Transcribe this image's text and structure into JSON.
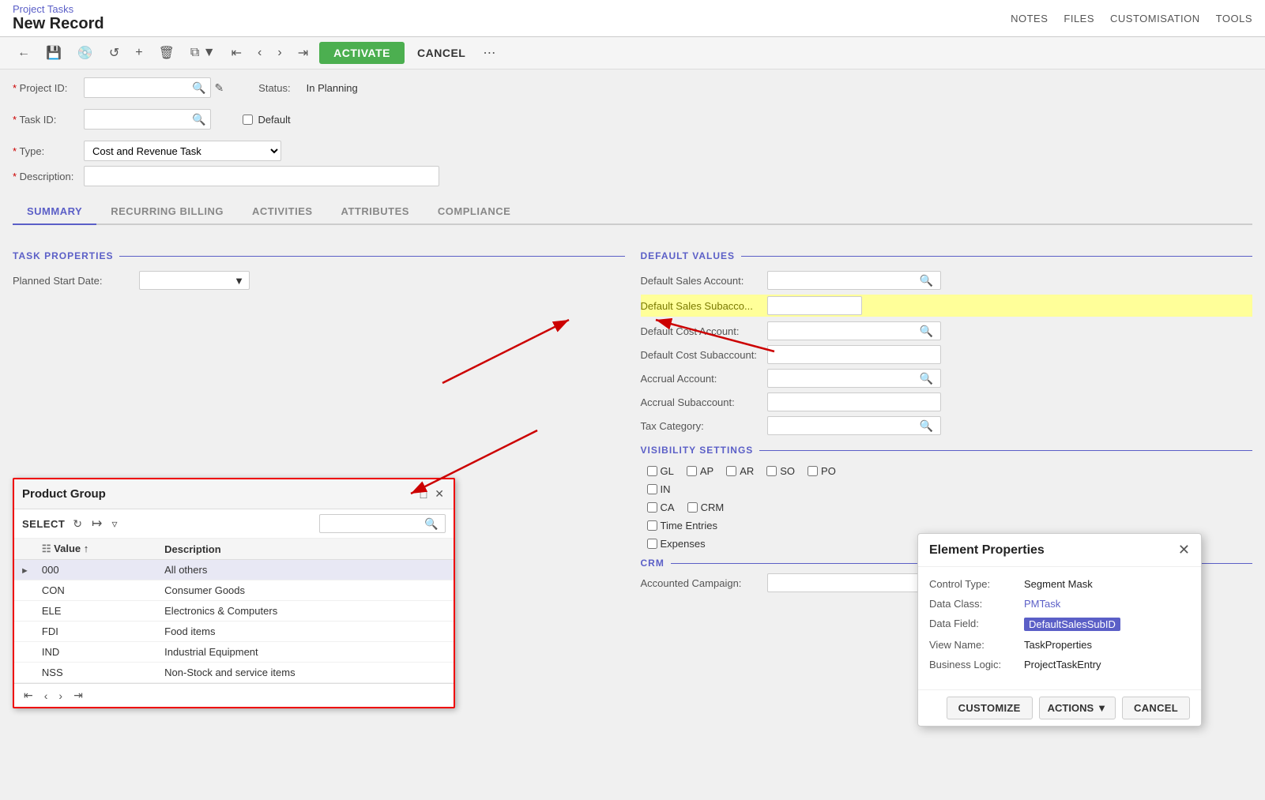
{
  "topbar": {
    "breadcrumb": "Project Tasks",
    "subtitle": "New Record",
    "notes_label": "NOTES",
    "files_label": "FILES",
    "customisation_label": "CUSTOMISATION",
    "tools_label": "TOOLS"
  },
  "toolbar": {
    "activate_label": "ACTIVATE",
    "cancel_label": "CANCEL"
  },
  "form": {
    "project_id_label": "Project ID:",
    "task_id_label": "Task ID:",
    "type_label": "Type:",
    "description_label": "Description:",
    "status_label": "Status:",
    "status_value": "In Planning",
    "default_checkbox_label": "Default",
    "type_value": "Cost and Revenue Task"
  },
  "tabs": [
    {
      "label": "SUMMARY"
    },
    {
      "label": "RECURRING BILLING"
    },
    {
      "label": "ACTIVITIES"
    },
    {
      "label": "ATTRIBUTES"
    },
    {
      "label": "COMPLIANCE"
    }
  ],
  "task_properties": {
    "section_label": "TASK PROPERTIES",
    "planned_start_date_label": "Planned Start Date:"
  },
  "default_values": {
    "section_label": "DEFAULT VALUES",
    "default_sales_account_label": "Default Sales Account:",
    "default_sales_subaccount_label": "Default Sales Subacco...",
    "default_cost_account_label": "Default Cost Account:",
    "default_cost_subaccount_label": "Default Cost Subaccount:",
    "accrual_account_label": "Accrual Account:",
    "accrual_subaccount_label": "Accrual Subaccount:",
    "tax_category_label": "Tax Category:",
    "dash_value": "—-—"
  },
  "visibility_settings": {
    "section_label": "VISIBILITY SETTINGS",
    "checkboxes": [
      {
        "id": "gl",
        "label": "GL"
      },
      {
        "id": "ap",
        "label": "AP"
      },
      {
        "id": "ar",
        "label": "AR"
      },
      {
        "id": "so",
        "label": "SO"
      },
      {
        "id": "po",
        "label": "PO"
      },
      {
        "id": "in",
        "label": "IN"
      },
      {
        "id": "ca",
        "label": "CA"
      },
      {
        "id": "crm",
        "label": "CRM"
      },
      {
        "id": "time",
        "label": "Time Entries"
      },
      {
        "id": "expenses",
        "label": "Expenses"
      }
    ]
  },
  "crm": {
    "section_label": "CRM",
    "accounted_campaign_label": "Accounted Campaign:"
  },
  "product_group_popup": {
    "title": "Product Group",
    "select_label": "SELECT",
    "columns": [
      {
        "label": "Value",
        "key": "value"
      },
      {
        "label": "Description",
        "key": "desc"
      }
    ],
    "rows": [
      {
        "expand": true,
        "value": "000",
        "desc": "All others",
        "selected": true
      },
      {
        "expand": false,
        "value": "CON",
        "desc": "Consumer Goods"
      },
      {
        "expand": false,
        "value": "ELE",
        "desc": "Electronics & Computers"
      },
      {
        "expand": false,
        "value": "FDI",
        "desc": "Food items"
      },
      {
        "expand": false,
        "value": "IND",
        "desc": "Industrial Equipment"
      },
      {
        "expand": false,
        "value": "NSS",
        "desc": "Non-Stock and service items"
      }
    ]
  },
  "element_properties": {
    "title": "Element Properties",
    "control_type_label": "Control Type:",
    "control_type_value": "Segment Mask",
    "data_class_label": "Data Class:",
    "data_class_value": "PMTask",
    "data_field_label": "Data Field:",
    "data_field_value": "DefaultSalesSubID",
    "view_name_label": "View Name:",
    "view_name_value": "TaskProperties",
    "business_logic_label": "Business Logic:",
    "business_logic_value": "ProjectTaskEntry",
    "customize_label": "CUSTOMIZE",
    "actions_label": "ACTIONS",
    "cancel_label": "CANCEL"
  }
}
